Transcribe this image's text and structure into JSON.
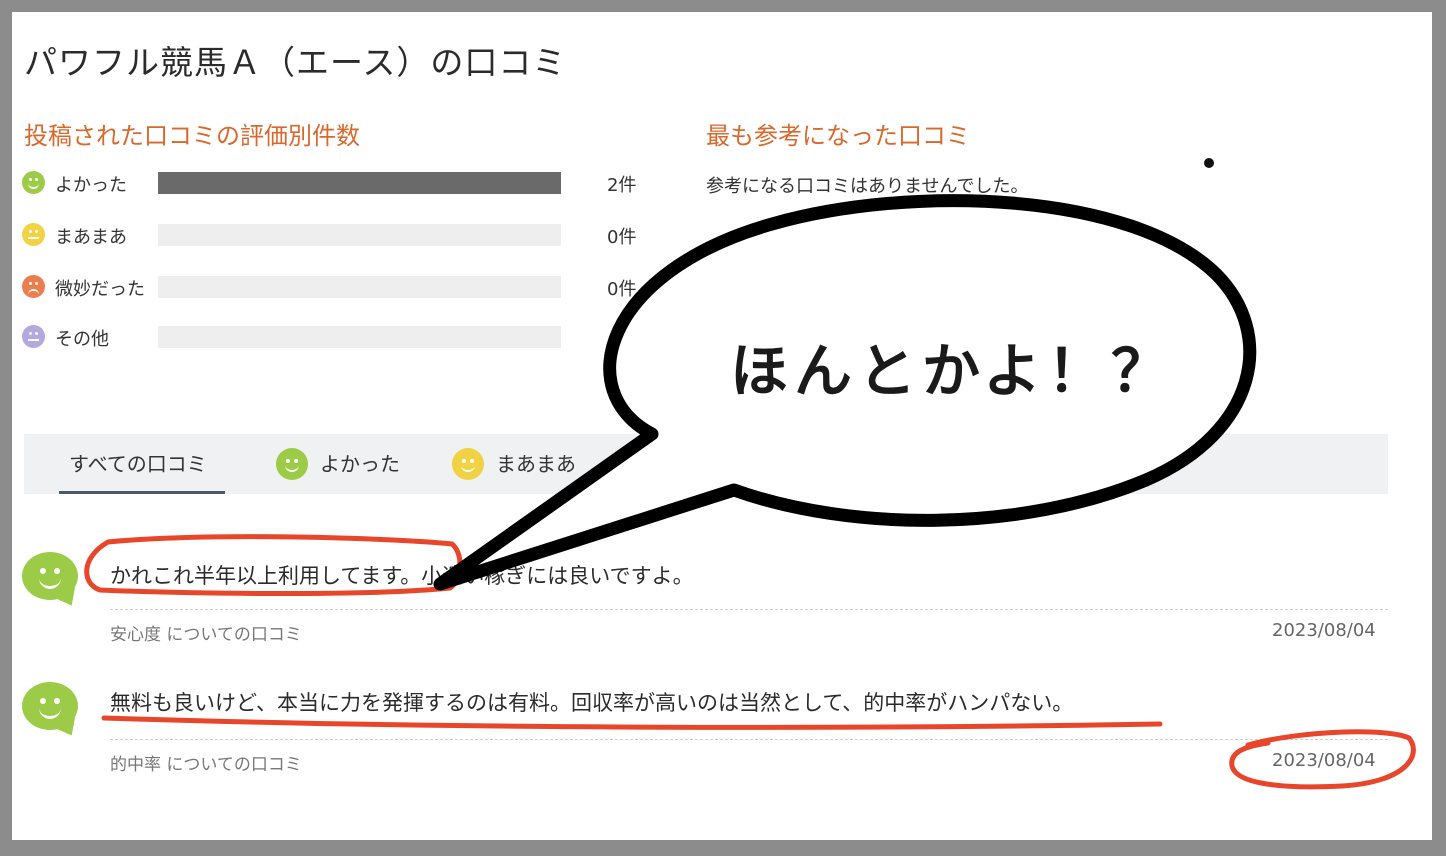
{
  "page": {
    "title": "パワフル競馬Ａ（エース）の口コミ"
  },
  "rating_summary": {
    "heading": "投稿された口コミの評価別件数",
    "rows": [
      {
        "label": "よかった",
        "count": "2件",
        "fraction": 1.0,
        "color": "#9ccc47"
      },
      {
        "label": "まあまあ",
        "count": "0件",
        "fraction": 0.0,
        "color": "#f2d245"
      },
      {
        "label": "微妙だった",
        "count": "0件",
        "fraction": 0.0,
        "color": "#ec7d4f"
      },
      {
        "label": "その他",
        "count": "",
        "fraction": 0.0,
        "color": "#b3a8e0"
      }
    ]
  },
  "helpful": {
    "heading": "最も参考になった口コミ",
    "empty_message": "参考になる口コミはありませんでした。"
  },
  "tabs": [
    {
      "label": "すべての口コミ",
      "active": true
    },
    {
      "label": "よかった",
      "icon": "smile-face-icon",
      "color": "#9ccc47"
    },
    {
      "label": "まあまあ",
      "icon": "neutral-face-icon",
      "color": "#f2d245"
    }
  ],
  "reviews": [
    {
      "text": "かれこれ半年以上利用してます。小遣い稼ぎには良いですよ。",
      "category": "安心度 についての口コミ",
      "date": "2023/08/04"
    },
    {
      "text": "無料も良いけど、本当に力を発揮するのは有料。回収率が高いのは当然として、的中率がハンパない。",
      "category": "的中率 についての口コミ",
      "date": "2023/08/04"
    }
  ],
  "overlay": {
    "speech_text": "ほんとかよ！？",
    "annotation_color": "#e8462a"
  }
}
